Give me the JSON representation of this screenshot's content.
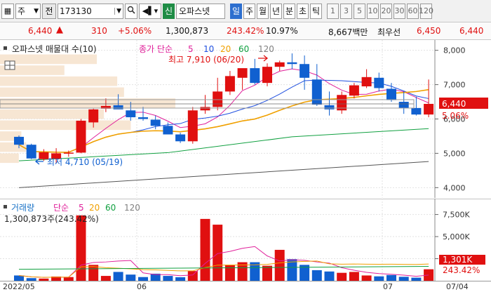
{
  "toolbar": {
    "market_code": "주",
    "prefix": "전",
    "stock_code": "173130",
    "sin_label": "신",
    "stock_name": "오파스넷",
    "periods": [
      "일",
      "주",
      "월",
      "년",
      "분",
      "초",
      "틱"
    ],
    "active_period": "일",
    "intervals": [
      "1",
      "3",
      "5",
      "10",
      "20",
      "30",
      "60",
      "120"
    ]
  },
  "price_bar": {
    "price": "6,440",
    "change": "310",
    "change_pct": "+5.06%",
    "volume": "1,300,873",
    "volume_ratio": "243.42%",
    "turnover": "10.97%",
    "amount": "8,667백만",
    "best_ask_label": "최우선",
    "best_ask": "6,450",
    "best_bid": "6,440"
  },
  "main_chart": {
    "title": "오파스넷 매물대 수(10)",
    "ma_legend": {
      "label": "종가 단순",
      "periods": [
        "5",
        "10",
        "20",
        "60",
        "120"
      ]
    },
    "high_annotation": "최고 7,910 (06/20)",
    "low_annotation": "최저 4,710 (05/19)",
    "price_box": "6,440",
    "pct_box": "5.06%",
    "y_ticks": [
      "8,000",
      "7,000",
      "6,000",
      "5,000",
      "4,000"
    ]
  },
  "volume_chart": {
    "legend_label": "거래량",
    "legend_ma": "단순",
    "legend_periods": [
      "5",
      "20",
      "60",
      "120"
    ],
    "current_text": "1,300,873주(243.42%)",
    "y_ticks": [
      "7,500K",
      "5,000K",
      "2,500K"
    ],
    "volume_box": "1,301K",
    "pct_box": "243.42%"
  },
  "x_axis": {
    "labels": [
      "2022/05",
      "06",
      "07",
      "07/04"
    ]
  },
  "colors": {
    "up": "#e01010",
    "down": "#1060d0",
    "ma5": "#e0209a",
    "ma10": "#2050e0",
    "ma20": "#f0a000",
    "ma60": "#10a040",
    "ma120": "#808080"
  },
  "chart_data": {
    "type": "candlestick",
    "x": [
      "05/16",
      "05/17",
      "05/18",
      "05/19",
      "05/20",
      "05/23",
      "05/24",
      "05/25",
      "05/26",
      "05/27",
      "05/30",
      "05/31",
      "06/02",
      "06/03",
      "06/07",
      "06/08",
      "06/09",
      "06/10",
      "06/13",
      "06/14",
      "06/15",
      "06/16",
      "06/17",
      "06/20",
      "06/21",
      "06/22",
      "06/23",
      "06/24",
      "06/27",
      "06/28",
      "06/29",
      "06/30",
      "07/01",
      "07/04"
    ],
    "open": [
      5480,
      5250,
      4830,
      4840,
      5000,
      5020,
      5900,
      6300,
      6400,
      6250,
      6050,
      5980,
      5800,
      5550,
      5350,
      6250,
      6350,
      6800,
      7200,
      7480,
      7050,
      7520,
      7650,
      7600,
      7150,
      6400,
      6250,
      6680,
      6950,
      7200,
      6880,
      6500,
      6320,
      6130
    ],
    "high": [
      5520,
      5280,
      5120,
      5150,
      5080,
      6000,
      6300,
      6600,
      6720,
      6500,
      6350,
      6100,
      5900,
      5600,
      6350,
      6700,
      7200,
      7400,
      7450,
      7750,
      7620,
      7700,
      7910,
      7850,
      7600,
      6800,
      6800,
      7050,
      7450,
      7350,
      7050,
      6800,
      6650,
      7150
    ],
    "low": [
      5150,
      4830,
      4780,
      4710,
      4900,
      5000,
      5750,
      6200,
      6300,
      5950,
      5950,
      5700,
      5550,
      5300,
      5280,
      6150,
      6250,
      6700,
      6850,
      7000,
      6950,
      7400,
      7450,
      6850,
      6380,
      6100,
      6150,
      6600,
      6900,
      6800,
      6500,
      6150,
      6100,
      6050
    ],
    "close": [
      5250,
      4850,
      5030,
      5000,
      5020,
      5950,
      6280,
      6380,
      6280,
      6050,
      6000,
      5800,
      5550,
      5350,
      6250,
      6350,
      6800,
      7250,
      7480,
      7050,
      7520,
      7650,
      7600,
      7200,
      6420,
      6280,
      6700,
      6980,
      7220,
      6900,
      6550,
      6320,
      6130,
      6440
    ],
    "volume_k": [
      600,
      300,
      250,
      480,
      420,
      7400,
      1800,
      550,
      1000,
      700,
      420,
      800,
      550,
      400,
      1100,
      7000,
      6350,
      1800,
      2100,
      2100,
      1700,
      3500,
      2450,
      1800,
      1200,
      1050,
      900,
      1000,
      600,
      500,
      650,
      450,
      350,
      1301
    ],
    "ylim": [
      3700,
      8300
    ],
    "volume_ylim": [
      0,
      8500
    ]
  }
}
